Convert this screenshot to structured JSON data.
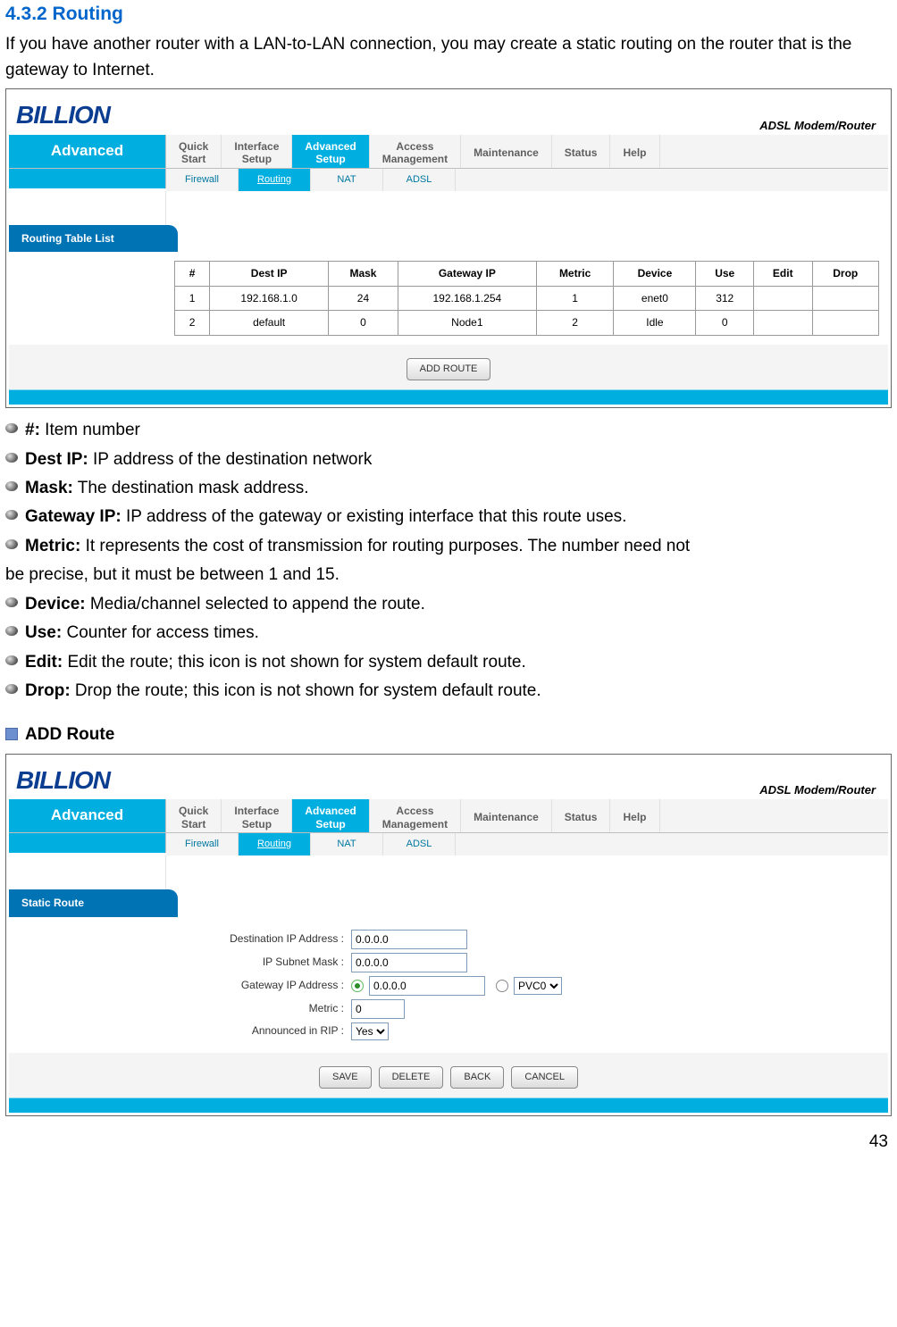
{
  "doc": {
    "section_number_title": "4.3.2 Routing",
    "intro": "If you have another router with a LAN-to-LAN connection, you may create a static routing on the router that is the gateway to Internet.",
    "page_number": "43"
  },
  "ui1": {
    "logo": "BILLION",
    "product": "ADSL Modem/Router",
    "left_title": "Advanced",
    "tabs": [
      "Quick\nStart",
      "Interface\nSetup",
      "Advanced\nSetup",
      "Access\nManagement",
      "Maintenance",
      "Status",
      "Help"
    ],
    "active_tab": 2,
    "subtabs": [
      "Firewall",
      "Routing",
      "NAT",
      "ADSL"
    ],
    "active_subtab": 1,
    "section_label": "Routing Table List",
    "table_headers": [
      "#",
      "Dest IP",
      "Mask",
      "Gateway IP",
      "Metric",
      "Device",
      "Use",
      "Edit",
      "Drop"
    ],
    "table_rows": [
      [
        "1",
        "192.168.1.0",
        "24",
        "192.168.1.254",
        "1",
        "enet0",
        "312",
        "",
        ""
      ],
      [
        "2",
        "default",
        "0",
        "Node1",
        "2",
        "Idle",
        "0",
        "",
        ""
      ]
    ],
    "button_add": "ADD ROUTE"
  },
  "definitions": [
    {
      "term": "#:",
      "text": " Item number"
    },
    {
      "term": "Dest IP:",
      "text": " IP address of the destination network"
    },
    {
      "term": "Mask:",
      "text": " The destination mask address."
    },
    {
      "term": "Gateway IP:",
      "text": " IP address of the gateway or existing interface that this route uses."
    },
    {
      "term": "Metric:",
      "text": " It represents the cost of transmission for routing purposes. The number need not"
    },
    {
      "term": "Device:",
      "text": " Media/channel selected to append the route."
    },
    {
      "term": "Use:",
      "text": " Counter for access times."
    },
    {
      "term": "Edit:",
      "text": " Edit the route; this icon is not shown for system default route."
    },
    {
      "term": "Drop:",
      "text": " Drop the route; this icon is not shown for system default route."
    }
  ],
  "metric_continuation": "be precise, but it must be between 1 and 15.",
  "add_route_heading": "ADD Route",
  "ui2": {
    "logo": "BILLION",
    "product": "ADSL Modem/Router",
    "left_title": "Advanced",
    "tabs": [
      "Quick\nStart",
      "Interface\nSetup",
      "Advanced\nSetup",
      "Access\nManagement",
      "Maintenance",
      "Status",
      "Help"
    ],
    "active_tab": 2,
    "subtabs": [
      "Firewall",
      "Routing",
      "NAT",
      "ADSL"
    ],
    "active_subtab": 1,
    "section_label": "Static Route",
    "form": {
      "dest_ip_label": "Destination IP Address :",
      "dest_ip_value": "0.0.0.0",
      "mask_label": "IP Subnet Mask :",
      "mask_value": "0.0.0.0",
      "gw_label": "Gateway IP Address :",
      "gw_value": "0.0.0.0",
      "gw_select": "PVC0",
      "metric_label": "Metric :",
      "metric_value": "0",
      "rip_label": "Announced in RIP :",
      "rip_value": "Yes"
    },
    "buttons": [
      "SAVE",
      "DELETE",
      "BACK",
      "CANCEL"
    ]
  }
}
